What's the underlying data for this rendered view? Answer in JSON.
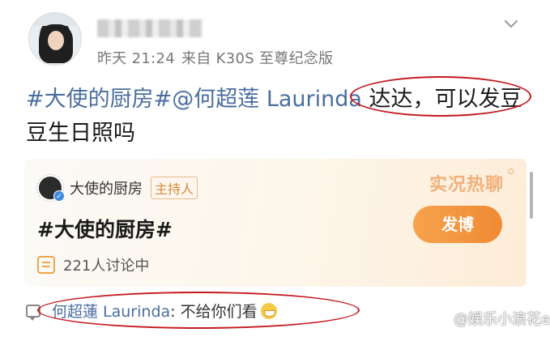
{
  "post": {
    "timestamp": "昨天 21:24",
    "source": "来自 K30S 至尊纪念版",
    "text_parts": {
      "topic": "#大使的厨房#",
      "mention": "@何超莲 Laurinda",
      "body": " 达达，可以发豆豆生日照吗"
    }
  },
  "card": {
    "account_name": "大使的厨房",
    "role_badge": "主持人",
    "live_label": "实况热聊",
    "topic": "#大使的厨房#",
    "post_button": "发博",
    "discussion_count": "221人讨论中"
  },
  "comment": {
    "author": "何超蓮 Laurinda",
    "text": ": 不给你们看"
  },
  "watermark": {
    "text": "@娱乐小浪花er"
  },
  "colors": {
    "link": "#4a6ea0",
    "annotation_ring": "#c4191f",
    "button_orange": "#f08a33"
  },
  "icons": [
    "avatar",
    "chevron-down-icon",
    "verified-icon",
    "chat-bubble-icon",
    "comment-icon",
    "grin-emoji-icon",
    "weibo-logo-icon"
  ]
}
